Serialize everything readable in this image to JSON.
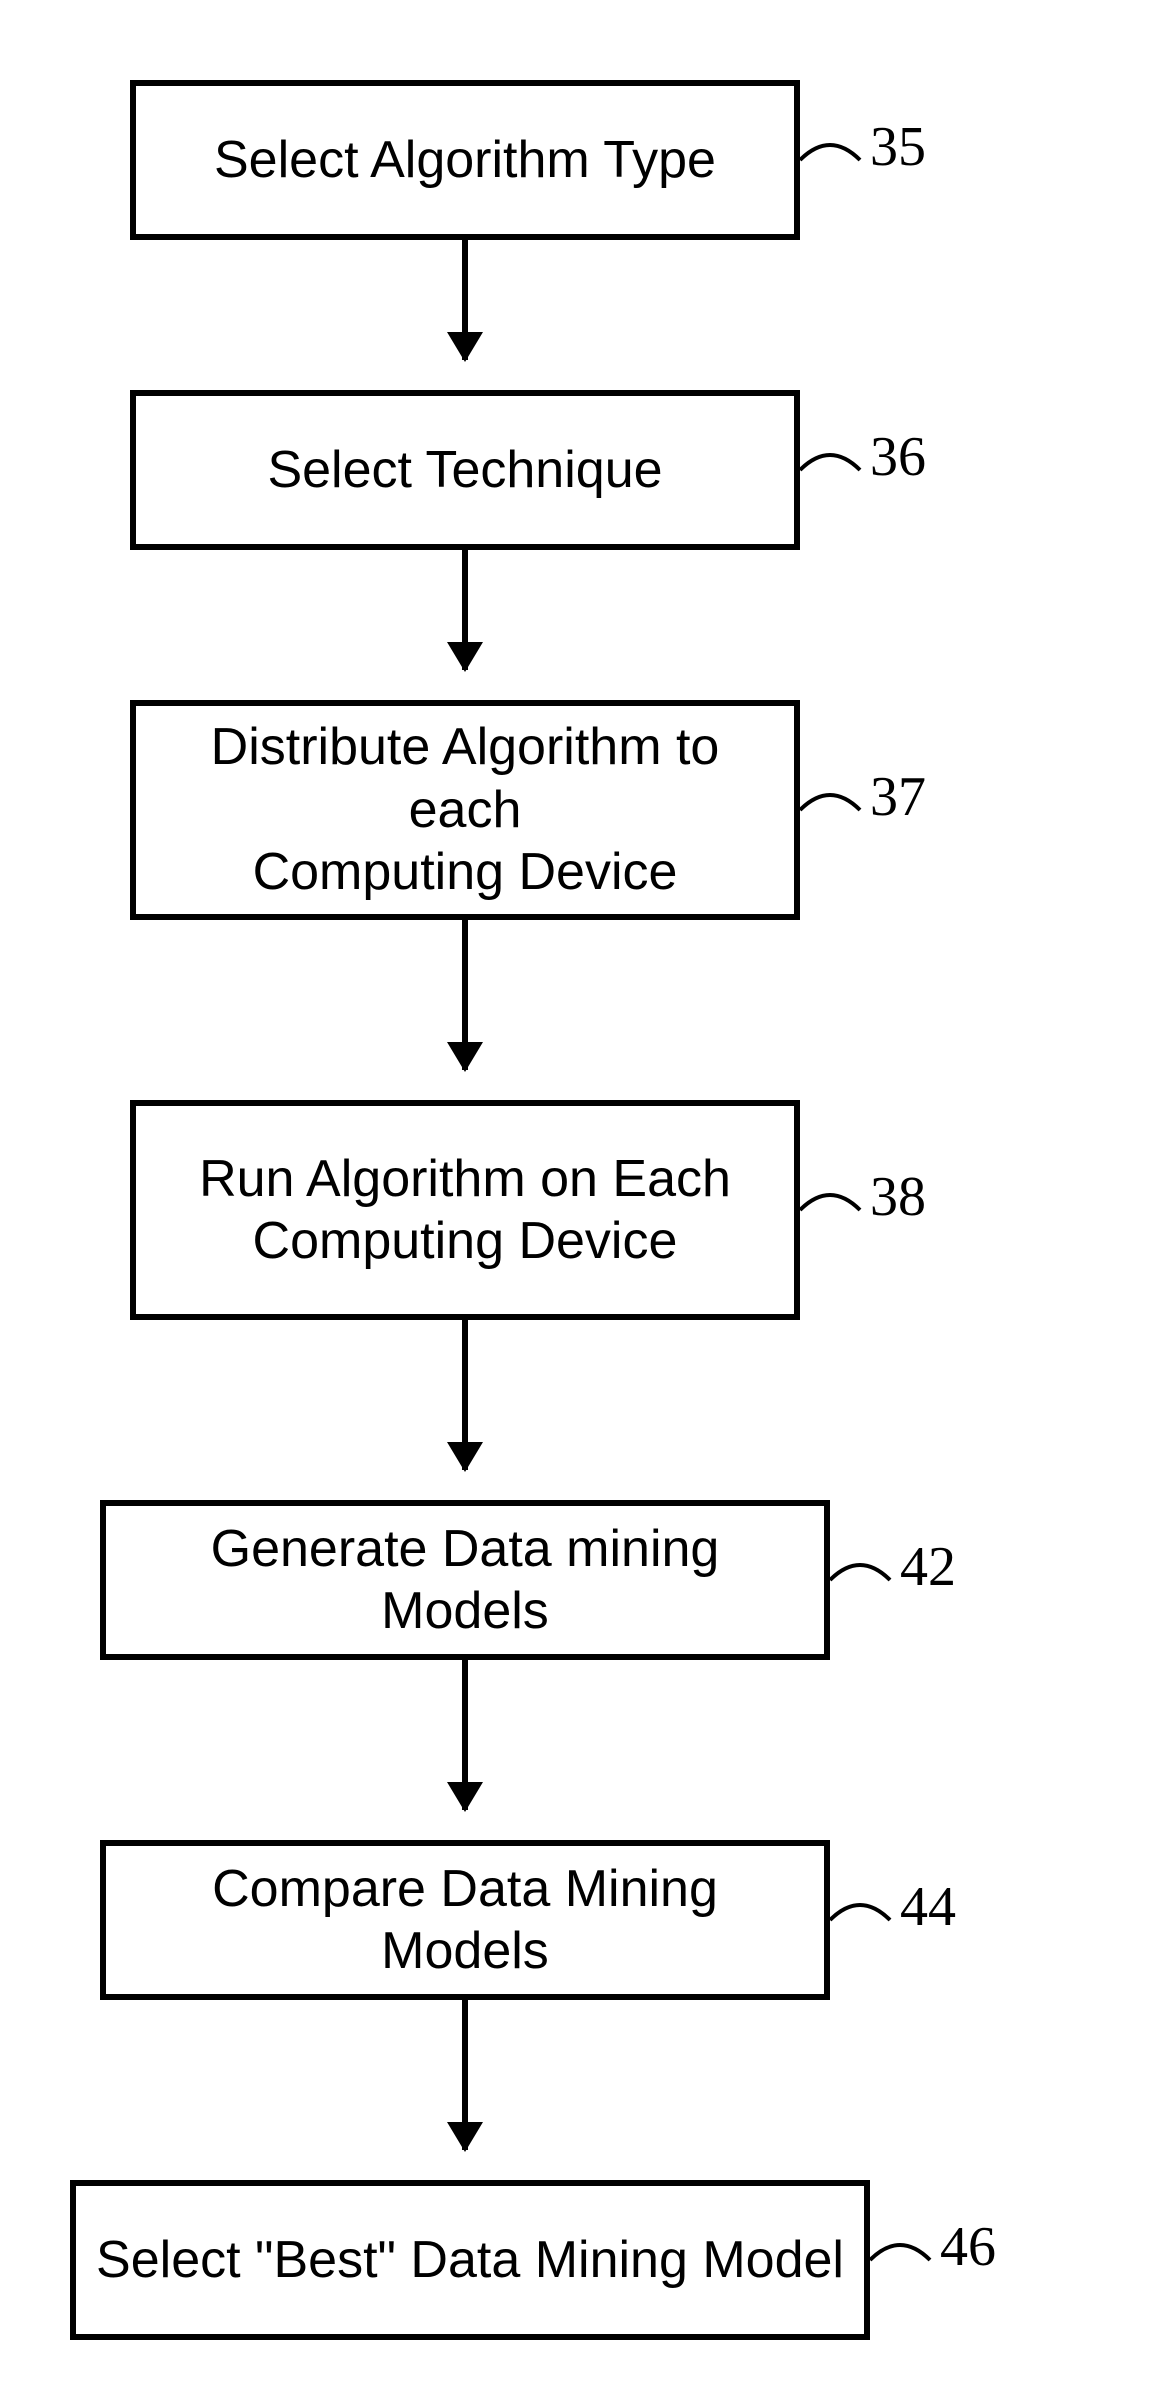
{
  "flow": {
    "steps": [
      {
        "text": "Select Algorithm Type",
        "num": "35"
      },
      {
        "text": "Select Technique",
        "num": "36"
      },
      {
        "text": "Distribute Algorithm to each\nComputing Device",
        "num": "37"
      },
      {
        "text": "Run Algorithm on Each\nComputing Device",
        "num": "38"
      },
      {
        "text": "Generate Data mining Models",
        "num": "42"
      },
      {
        "text": "Compare Data Mining Models",
        "num": "44"
      },
      {
        "text": "Select \"Best\" Data Mining Model",
        "num": "46"
      }
    ]
  }
}
